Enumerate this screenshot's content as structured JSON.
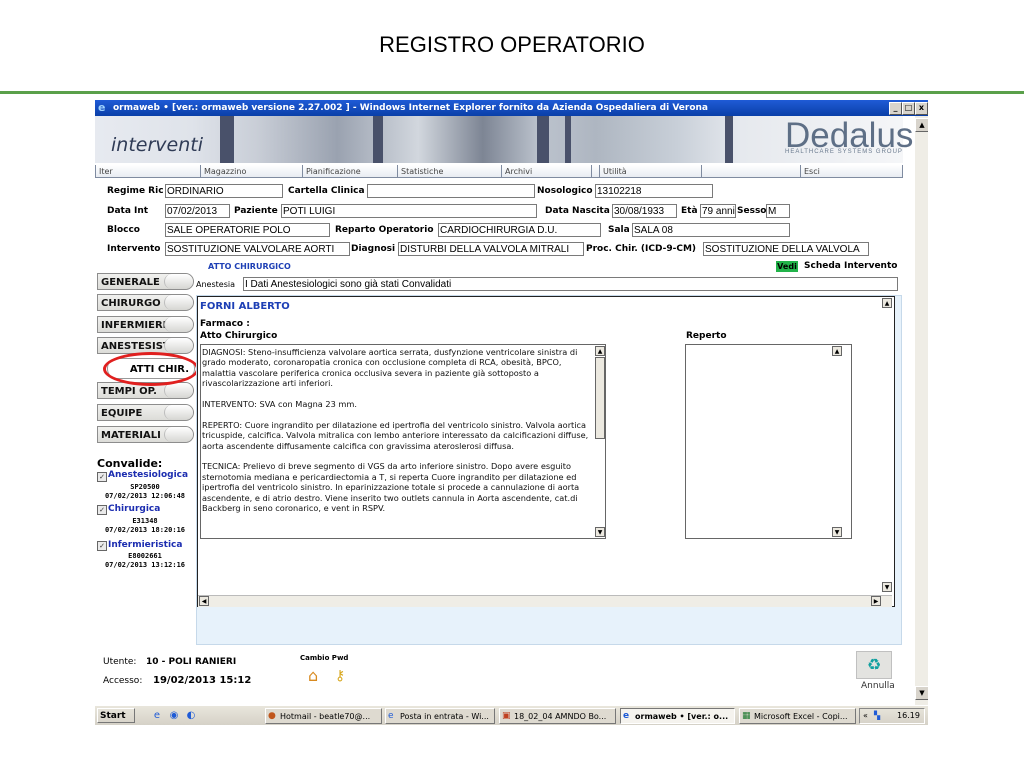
{
  "slide": {
    "title": "REGISTRO OPERATORIO"
  },
  "window": {
    "title": "ormaweb • [ver.: ormaweb versione 2.27.002 ] - Windows Internet Explorer fornito da Azienda Ospedaliera di Verona",
    "minimize": "_",
    "maximize": "□",
    "close": "x"
  },
  "banner": {
    "title": "interventi",
    "logo": "Dedalus",
    "logo_sub": "HEALTHCARE SYSTEMS GROUP"
  },
  "menu": [
    "Iter",
    "Magazzino",
    "Pianificazione",
    "Statistiche",
    "Archivi",
    "",
    "Utilità",
    "",
    "Esci"
  ],
  "form": {
    "regime_label": "Regime Ric",
    "regime_value": "ORDINARIO",
    "cartella_label": "Cartella Clinica",
    "cartella_value": "",
    "nosologico_label": "Nosologico",
    "nosologico_value": "13102218",
    "data_int_label": "Data Int",
    "data_int_value": "07/02/2013",
    "paziente_label": "Paziente",
    "paziente_value": "POTI LUIGI",
    "nascita_label": "Data Nascita",
    "nascita_value": "30/08/1933",
    "eta_label": "Età",
    "eta_value": "79 anni",
    "sesso_label": "Sesso",
    "sesso_value": "M",
    "blocco_label": "Blocco",
    "blocco_value": "SALE OPERATORIE POLO",
    "reparto_label": "Reparto Operatorio",
    "reparto_value": "CARDIOCHIRURGIA D.U.",
    "sala_label": "Sala",
    "sala_value": "SALA 08",
    "intervento_label": "Intervento",
    "intervento_value": "SOSTITUZIONE VALVOLARE AORTI",
    "diagnosi_label": "Diagnosi",
    "diagnosi_value": "DISTURBI DELLA VALVOLA MITRALI",
    "proc_label": "Proc. Chir. (ICD-9-CM)",
    "proc_value": "SOSTITUZIONE DELLA VALVOLA"
  },
  "section": {
    "title": "ATTO CHIRURGICO",
    "vedi": "Vedi",
    "scheda": "Scheda Intervento"
  },
  "anestesia": {
    "label": "Anestesia",
    "value": "I Dati Anestesiologici sono già stati Convalidati"
  },
  "tabs": [
    "GENERALE",
    "CHIRURGO",
    "INFERMIERE",
    "ANESTESISTA",
    "TEMPI OP.",
    "EQUIPE",
    "MATERIALI"
  ],
  "sub_tab": "ATTI CHIR.",
  "convalide": {
    "title": "Convalide:",
    "items": [
      {
        "name": "Anestesiologica",
        "code": "SP20500",
        "date": "07/02/2013 12:06:48"
      },
      {
        "name": "Chirurgica",
        "code": "E31348",
        "date": "07/02/2013 18:20:16"
      },
      {
        "name": "Infermieristica",
        "code": "E8002661",
        "date": "07/02/2013 13:12:16"
      }
    ]
  },
  "content": {
    "surgeon": "FORNI ALBERTO",
    "farmaco_label": "Farmaco :",
    "atto_label": "Atto Chirurgico",
    "reperto_label": "Reperto",
    "atto_text": "DIAGNOSI: Steno-insufficienza valvolare aortica serrata, dusfynzione ventricolare sinistra di grado moderato, coronaropatia cronica con occlusione completa di RCA, obesità, BPCO, malattia vascolare periferica cronica occlusiva severa in paziente già sottoposto a rivascolarizzazione arti inferiori.\n\nINTERVENTO: SVA con Magna 23 mm.\n\nREPERTO: Cuore ingrandito per dilatazione ed ipertrofia del ventricolo sinistro. Valvola aortica tricuspide, calcifica. Valvola mitralica con lembo anteriore interessato da calcificazioni diffuse, aorta ascendente diffusamente calcifica con gravissima ateroslerosi diffusa.\n\nTECNICA: Prelievo di breve segmento di VGS da arto inferiore sinistro. Dopo avere esguito sternotomia mediana e pericardiectomia a T, si reperta Cuore ingrandito per dilatazione ed ipertrofia del ventricolo sinistro. In eparinizzazione totale si procede a cannulazione di aorta  ascendente, e di atrio destro. Viene inserito two outlets cannula in Aorta ascendente, cat.di Backberg in seno coronarico, e vent in RSPV."
  },
  "footer": {
    "utente_label": "Utente:",
    "utente_value": "10 - POLI RANIERI",
    "accesso_label": "Accesso:",
    "accesso_value": "19/02/2013 15:12",
    "cambio": "Cambio Pwd",
    "annulla": "Annulla"
  },
  "taskbar": {
    "start": "Start",
    "items": [
      "Hotmail - beatle70@...",
      "Posta in entrata - Wi...",
      "18_02_04 AMNDO Bo...",
      "ormaweb • [ver.: o...",
      "Microsoft Excel - Copi..."
    ],
    "tray_chevron": "«",
    "clock": "16.19"
  }
}
